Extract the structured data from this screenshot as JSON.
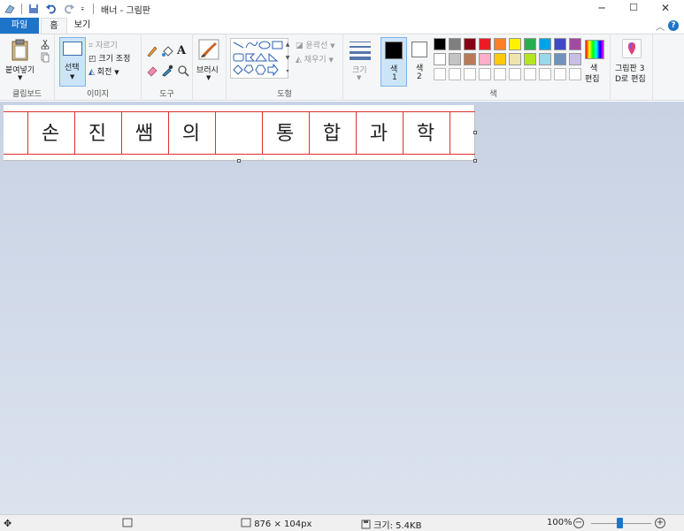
{
  "window": {
    "title": "배너 - 그림판",
    "controls": {
      "minimize": "─",
      "maximize": "☐",
      "close": "✕"
    }
  },
  "tabs": {
    "file": "파일",
    "home": "홈",
    "view": "보기"
  },
  "ribbon": {
    "clipboard": {
      "paste": "붙여넣기",
      "group": "클립보드"
    },
    "image": {
      "select": "선택",
      "crop": "자르기",
      "resize": "크기 조정",
      "rotate": "회전",
      "group": "이미지"
    },
    "tools": {
      "group": "도구"
    },
    "brushes": {
      "label": "브러시"
    },
    "shapes": {
      "outline": "윤곽선",
      "fill": "채우기",
      "group": "도형"
    },
    "size": {
      "label": "크기"
    },
    "colors": {
      "color1": "색\n1",
      "color1_line1": "색",
      "color1_line2": "1",
      "color2_line1": "색",
      "color2_line2": "2",
      "edit_line1": "색",
      "edit_line2": "편집",
      "group": "색",
      "palette_row1": [
        "#000000",
        "#7f7f7f",
        "#880015",
        "#ed1c24",
        "#ff7f27",
        "#fff200",
        "#22b14c",
        "#00a2e8",
        "#3f48cc",
        "#a349a4"
      ],
      "palette_row2": [
        "#ffffff",
        "#c3c3c3",
        "#b97a57",
        "#ffaec9",
        "#ffc90e",
        "#efe4b0",
        "#b5e61d",
        "#99d9ea",
        "#7092be",
        "#c8bfe7"
      ]
    },
    "paint3d": {
      "line1": "그림판 3",
      "line2": "D로 편집"
    }
  },
  "canvas": {
    "cells": [
      "손",
      "진",
      "쌤",
      "의",
      "",
      "통",
      "합",
      "과",
      "학"
    ]
  },
  "status": {
    "dimensions": "876 × 104px",
    "filesize": "크기: 5.4KB",
    "zoom": "100%",
    "zoom_minus": "−",
    "zoom_plus": "+"
  }
}
